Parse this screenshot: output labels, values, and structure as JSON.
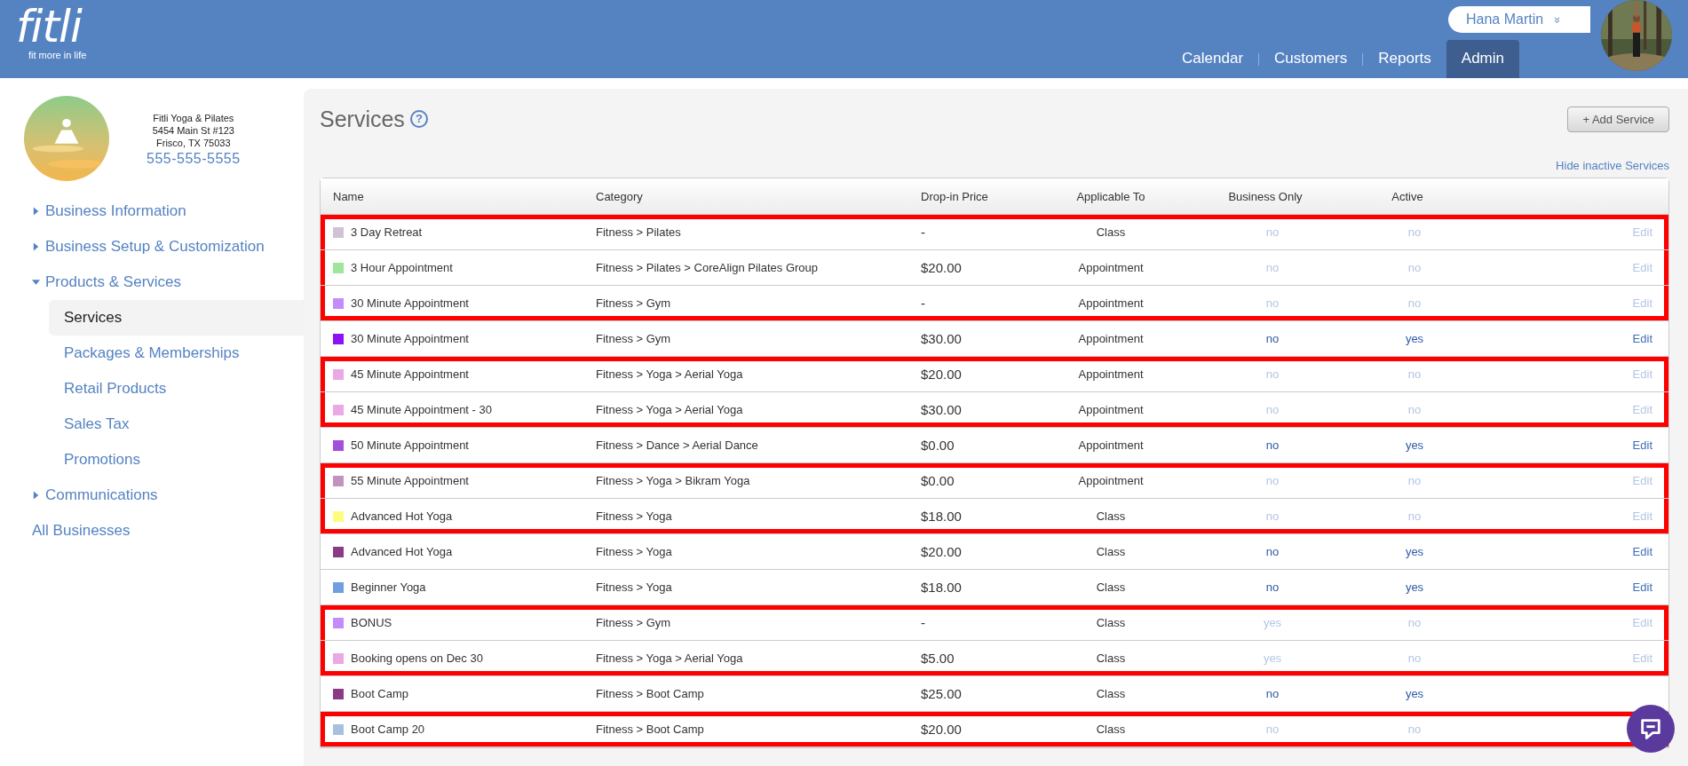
{
  "header": {
    "logo": "fitli",
    "tagline": "fit more in life",
    "user": {
      "name": "Hana Martin",
      "caret": "»"
    },
    "nav": [
      {
        "label": "Calendar",
        "selected": false
      },
      {
        "label": "Customers",
        "selected": false
      },
      {
        "label": "Reports",
        "selected": false
      },
      {
        "label": "Admin",
        "selected": true
      }
    ]
  },
  "business": {
    "name": "Fitli Yoga & Pilates",
    "address": "5454 Main St #123",
    "city": "Frisco, TX 75033",
    "phone": "555-555-5555"
  },
  "sidebar": {
    "items": [
      {
        "label": "Business Information",
        "kind": "section",
        "expanded": false
      },
      {
        "label": "Business Setup & Customization",
        "kind": "section",
        "expanded": false
      },
      {
        "label": "Products & Services",
        "kind": "section",
        "expanded": true,
        "children": [
          {
            "label": "Services",
            "selected": true
          },
          {
            "label": "Packages & Memberships",
            "selected": false
          },
          {
            "label": "Retail Products",
            "selected": false
          },
          {
            "label": "Sales Tax",
            "selected": false
          },
          {
            "label": "Promotions",
            "selected": false
          }
        ]
      },
      {
        "label": "Communications",
        "kind": "section",
        "expanded": false
      },
      {
        "label": "All Businesses",
        "kind": "link"
      }
    ]
  },
  "page": {
    "title": "Services",
    "help": "?",
    "add_button": "+ Add Service",
    "hide_link": "Hide inactive Services"
  },
  "table": {
    "columns": [
      "Name",
      "Category",
      "Drop-in Price",
      "Applicable To",
      "Business Only",
      "Active"
    ],
    "rows": [
      {
        "color": "#d0c3d3",
        "name": "3 Day Retreat",
        "category": "Fitness > Pilates",
        "price": "-",
        "applicable": "Class",
        "business_only": "no",
        "active": "no",
        "edit": "Edit",
        "enabled": false,
        "flagged": true
      },
      {
        "color": "#9de69a",
        "name": "3 Hour Appointment",
        "category": "Fitness > Pilates > CoreAlign Pilates Group",
        "price": "$20.00",
        "applicable": "Appointment",
        "business_only": "no",
        "active": "no",
        "edit": "Edit",
        "enabled": false,
        "flagged": true
      },
      {
        "color": "#c48cf8",
        "name": "30 Minute Appointment",
        "category": "Fitness > Gym",
        "price": "-",
        "applicable": "Appointment",
        "business_only": "no",
        "active": "no",
        "edit": "Edit",
        "enabled": false,
        "flagged": true
      },
      {
        "color": "#8b12f5",
        "name": "30 Minute Appointment",
        "category": "Fitness > Gym",
        "price": "$30.00",
        "applicable": "Appointment",
        "business_only": "no",
        "active": "yes",
        "edit": "Edit",
        "enabled": true,
        "flagged": false
      },
      {
        "color": "#eaa8e4",
        "name": "45 Minute Appointment",
        "category": "Fitness > Yoga > Aerial Yoga",
        "price": "$20.00",
        "applicable": "Appointment",
        "business_only": "no",
        "active": "no",
        "edit": "Edit",
        "enabled": false,
        "flagged": true
      },
      {
        "color": "#eaa8e4",
        "name": "45 Minute Appointment - 30",
        "category": "Fitness > Yoga > Aerial Yoga",
        "price": "$30.00",
        "applicable": "Appointment",
        "business_only": "no",
        "active": "no",
        "edit": "Edit",
        "enabled": false,
        "flagged": true
      },
      {
        "color": "#a24fdb",
        "name": "50 Minute Appointment",
        "category": "Fitness > Dance > Aerial Dance",
        "price": "$0.00",
        "applicable": "Appointment",
        "business_only": "no",
        "active": "yes",
        "edit": "Edit",
        "enabled": true,
        "flagged": false
      },
      {
        "color": "#c293bd",
        "name": "55 Minute Appointment",
        "category": "Fitness > Yoga > Bikram Yoga",
        "price": "$0.00",
        "applicable": "Appointment",
        "business_only": "no",
        "active": "no",
        "edit": "Edit",
        "enabled": false,
        "flagged": true
      },
      {
        "color": "#fcfc7e",
        "name": "Advanced Hot Yoga",
        "category": "Fitness > Yoga",
        "price": "$18.00",
        "applicable": "Class",
        "business_only": "no",
        "active": "no",
        "edit": "Edit",
        "enabled": false,
        "flagged": true
      },
      {
        "color": "#8d3a86",
        "name": "Advanced Hot Yoga",
        "category": "Fitness > Yoga",
        "price": "$20.00",
        "applicable": "Class",
        "business_only": "no",
        "active": "yes",
        "edit": "Edit",
        "enabled": true,
        "flagged": false
      },
      {
        "color": "#6f9fe0",
        "name": "Beginner Yoga",
        "category": "Fitness > Yoga",
        "price": "$18.00",
        "applicable": "Class",
        "business_only": "no",
        "active": "yes",
        "edit": "Edit",
        "enabled": true,
        "flagged": false
      },
      {
        "color": "#c48cf8",
        "name": "BONUS",
        "category": "Fitness > Gym",
        "price": "-",
        "applicable": "Class",
        "business_only": "yes",
        "active": "no",
        "edit": "Edit",
        "enabled": false,
        "flagged": true
      },
      {
        "color": "#eaa8e4",
        "name": "Booking opens on Dec 30",
        "category": "Fitness > Yoga > Aerial Yoga",
        "price": "$5.00",
        "applicable": "Class",
        "business_only": "yes",
        "active": "no",
        "edit": "Edit",
        "enabled": false,
        "flagged": true
      },
      {
        "color": "#8d3a86",
        "name": "Boot Camp",
        "category": "Fitness > Boot Camp",
        "price": "$25.00",
        "applicable": "Class",
        "business_only": "no",
        "active": "yes",
        "enabled": true,
        "flagged": false
      },
      {
        "color": "#a8c0e0",
        "name": "Boot Camp 20",
        "category": "Fitness > Boot Camp",
        "price": "$20.00",
        "applicable": "Class",
        "business_only": "no",
        "active": "no",
        "enabled": false,
        "flagged": true
      }
    ]
  }
}
